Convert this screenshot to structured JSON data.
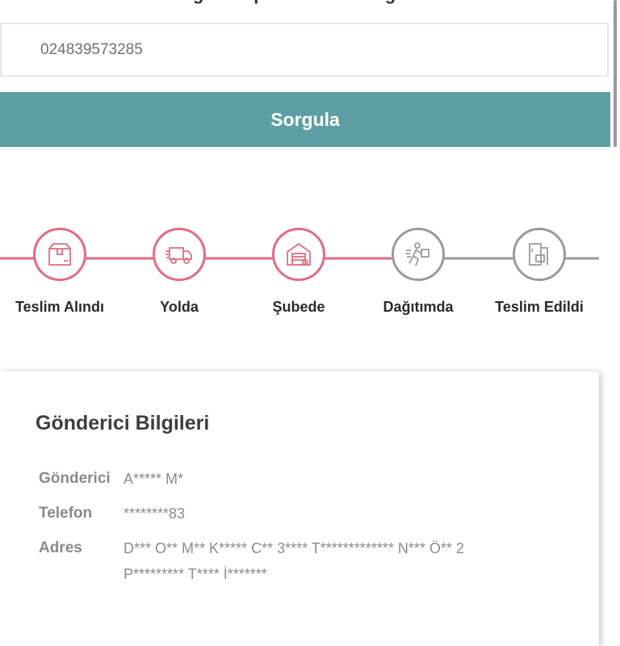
{
  "header": {
    "title": "Kargo Takip Numarası Sorgulama"
  },
  "search": {
    "value": "024839573285",
    "placeholder": ""
  },
  "query_button": {
    "label": "Sorgula",
    "color": "#5e9ea5"
  },
  "timeline": {
    "active_color": "#e36b82",
    "inactive_color": "#9a9a9a",
    "steps": [
      {
        "label": "Teslim Alındı",
        "icon": "package-icon",
        "status": "done"
      },
      {
        "label": "Yolda",
        "icon": "delivery-truck-icon",
        "status": "done"
      },
      {
        "label": "Şubede",
        "icon": "warehouse-icon",
        "status": "done"
      },
      {
        "label": "Dağıtımda",
        "icon": "running-courier-icon",
        "status": "pending"
      },
      {
        "label": "Teslim Edildi",
        "icon": "door-delivered-icon",
        "status": "pending"
      }
    ]
  },
  "sender_card": {
    "title": "Gönderici Bilgileri",
    "fields": [
      {
        "label": "Gönderici",
        "value": "A***** M*"
      },
      {
        "label": "Telefon",
        "value": "********83"
      },
      {
        "label": "Adres",
        "value_line1": "D*** O** M** K***** C** 3**** T************* N*** Ö** 2",
        "value_line2": "P********* T**** İ*******"
      }
    ]
  }
}
